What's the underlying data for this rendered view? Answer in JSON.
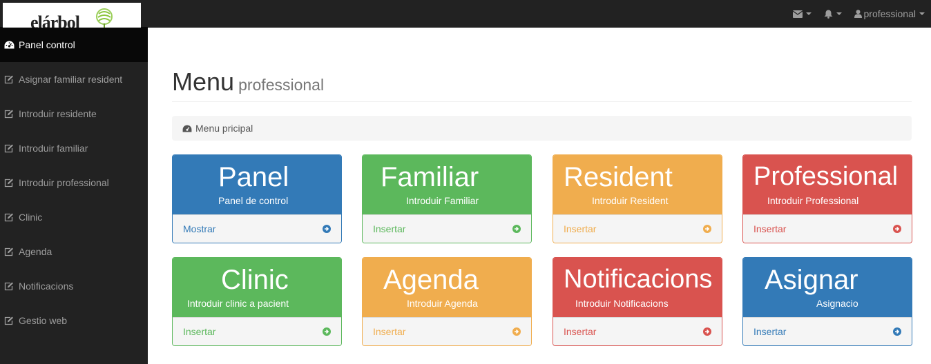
{
  "header": {
    "logo_text": "elárbol",
    "user_label": "professional"
  },
  "sidebar": {
    "items": [
      {
        "label": "Panel control",
        "icon": "dashboard-icon"
      },
      {
        "label": "Asignar familiar resident",
        "icon": "edit-icon"
      },
      {
        "label": "Introduir residente",
        "icon": "edit-icon"
      },
      {
        "label": "Introduir familiar",
        "icon": "edit-icon"
      },
      {
        "label": "Introduir professional",
        "icon": "edit-icon"
      },
      {
        "label": "Clinic",
        "icon": "edit-icon"
      },
      {
        "label": "Agenda",
        "icon": "edit-icon"
      },
      {
        "label": "Notificacions",
        "icon": "edit-icon"
      },
      {
        "label": "Gestio web",
        "icon": "edit-icon"
      }
    ]
  },
  "main": {
    "title": "Menu",
    "subtitle": "professional",
    "breadcrumb": "Menu pricipal"
  },
  "colors": {
    "primary": "#337ab7",
    "success": "#5cb85c",
    "warning": "#f0ad4e",
    "danger": "#d9534f"
  },
  "cards": [
    {
      "title": "Panel",
      "subtitle": "Panel de control",
      "action": "Mostrar",
      "color": "#337ab7"
    },
    {
      "title": "Familiar",
      "subtitle": "Introduir Familiar",
      "action": "Insertar",
      "color": "#5cb85c"
    },
    {
      "title": "Resident",
      "subtitle": "Introduir Resident",
      "action": "Insertar",
      "color": "#f0ad4e"
    },
    {
      "title": "Professional",
      "subtitle": "Introduir Professional",
      "action": "Insertar",
      "color": "#d9534f"
    },
    {
      "title": "Clinic",
      "subtitle": "Introduir clinic a pacient",
      "action": "Insertar",
      "color": "#5cb85c"
    },
    {
      "title": "Agenda",
      "subtitle": "Introduir Agenda",
      "action": "Insertar",
      "color": "#f0ad4e"
    },
    {
      "title": "Notificacions",
      "subtitle": "Introduir Notificacions",
      "action": "Insertar",
      "color": "#d9534f"
    },
    {
      "title": "Asignar",
      "subtitle": "Asignacio",
      "action": "Insertar",
      "color": "#337ab7"
    }
  ]
}
